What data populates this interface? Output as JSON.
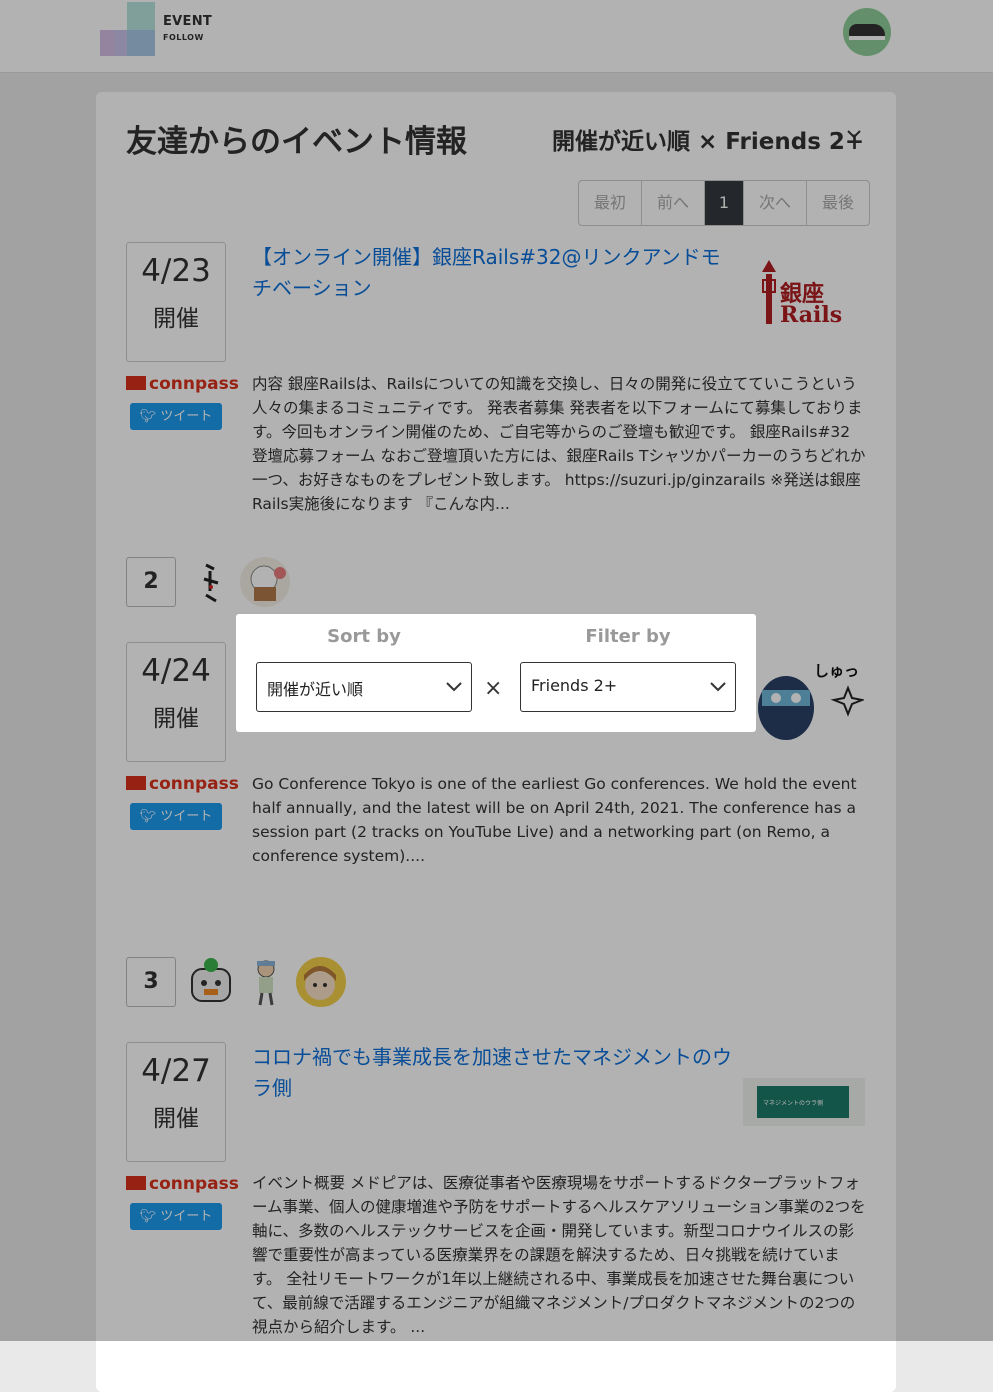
{
  "header": {
    "logo_line1": "EVENT",
    "logo_line2": "FOLLOW",
    "avatar_icon": "sneaker-avatar"
  },
  "page": {
    "title": "友達からのイベント情報",
    "sort_summary": "開催が近い順 × Friends 2+"
  },
  "pagination": [
    "最初",
    "前へ",
    "1",
    "次へ",
    "最後"
  ],
  "events": [
    {
      "date": "4/23",
      "kaisai": "開催",
      "service": "connpass",
      "tweet": "ツイート",
      "title": "【オンライン開催】銀座Rails#32@リンクアンドモチベーション",
      "thumb_text_1": "銀座",
      "thumb_text_2": "Rails",
      "description": "内容 銀座Railsは、Railsについての知識を交換し、日々の開発に役立てていこうという人々の集まるコミュニティです。 発表者募集 発表者を以下フォームにて募集しております。今回もオンライン開催のため、ご自宅等からのご登壇も歓迎です。 銀座Rails#32 登壇応募フォーム なおご登壇頂いた方には、銀座Rails Tシャツかパーカーのうちどれか一つ、お好きなものをプレゼント致します。 https://suzuri.jp/ginzarails ※発送は銀座Rails実施後になります 『こんな内..."
    },
    {
      "count": "2",
      "date": "4/24",
      "kaisai": "開催",
      "service": "connpass",
      "tweet": "ツイート",
      "thumb_text": "しゅっ",
      "description": "Go Conference Tokyo is one of the earliest Go conferences. We hold the event half annually, and the latest will be on April 24th, 2021. The conference has a session part (2 tracks on YouTube Live) and a networking part (on Remo, a conference system)...."
    },
    {
      "count": "3",
      "date": "4/27",
      "kaisai": "開催",
      "service": "connpass",
      "tweet": "ツイート",
      "title": "コロナ禍でも事業成長を加速させたマネジメントのウラ側",
      "thumb_text": "マネジメントのウラ側",
      "description": "イベント概要 メドピアは、医療従事者や医療現場をサポートするドクタープラットフォーム事業、個人の健康増進や予防をサポートするヘルスケアソリューション事業の2つを軸に、多数のヘルステックサービスを企画・開発しています。新型コロナウイルスの影響で重要性が高まっている医療業界をの課題を解決するため、日々挑戦を続けています。 全社リモートワークが1年以上継続される中、事業成長を加速させた舞台裏について、最前線で活躍するエンジニアが組織マネジメント/プロダクトマネジメントの2つの視点から紹介します。 ..."
    }
  ],
  "modal": {
    "sort_label": "Sort by",
    "filter_label": "Filter by",
    "sort_value": "開催が近い順",
    "filter_value": "Friends 2+",
    "times": "×"
  }
}
